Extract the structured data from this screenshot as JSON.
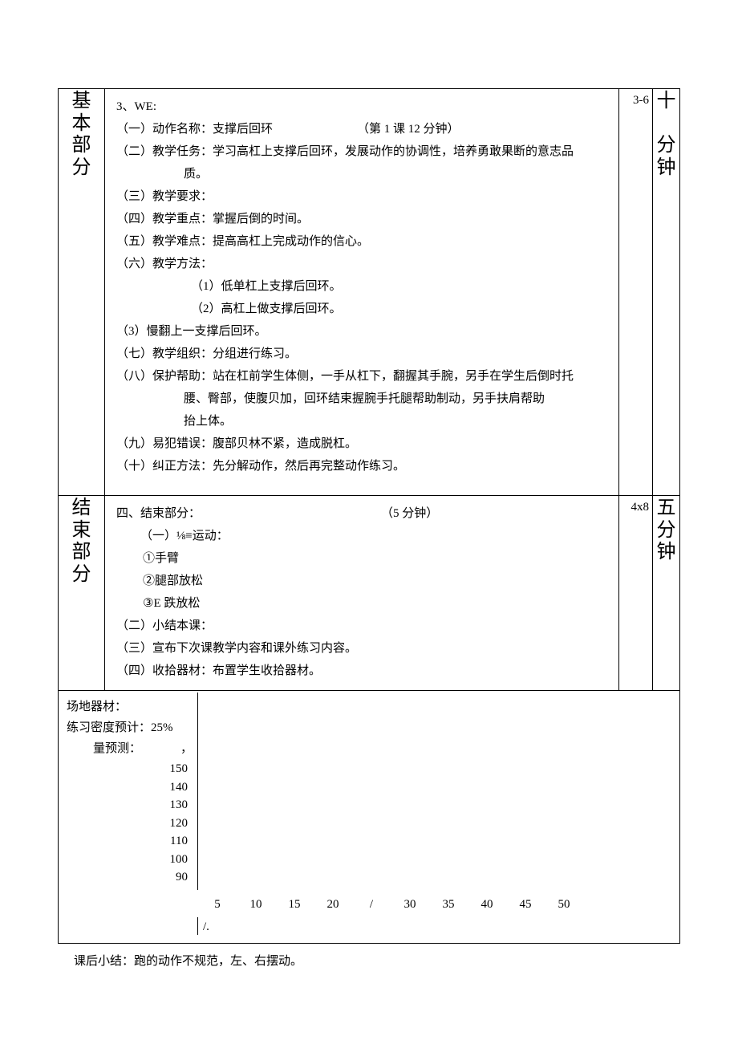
{
  "sections": {
    "basic": {
      "title_chars": [
        "基",
        "本",
        "部",
        "分"
      ],
      "count": "3-6",
      "time_chars": [
        "十",
        "",
        "分",
        "钟"
      ],
      "lines": {
        "l3": "3、WE:",
        "l_a": "（一）动作名称：支撑后回环",
        "l_a_right": "（第 1 课 12 分钟）",
        "l_b": "（二）教学任务：学习高杠上支撑后回环，发展动作的协调性，培养勇敢果断的意志品",
        "l_b2": "质。",
        "l_c": "（三）教学要求：",
        "l_d": "（四）教学重点：掌握后倒的时间。",
        "l_e": "（五）教学难点：提高高杠上完成动作的信心。",
        "l_f": "（六）教学方法：",
        "l_f1": "（1）低单杠上支撑后回环。",
        "l_f2": "（2）高杠上做支撑后回环。",
        "l_f3": "（3）慢翻上一支撑后回环。",
        "l_g": "（七）教学组织：分组进行练习。",
        "l_h": "（八）保护帮助：站在杠前学生体侧，一手从杠下，翻握其手腕，另手在学生后倒时托",
        "l_h2": "腰、臀部，使腹贝加，回环结束握腕手托腿帮助制动，另手扶肩帮助",
        "l_h3": "抬上体。",
        "l_i": "（九）易犯错误：腹部贝林不紧，造成脱杠。",
        "l_j": "（十）纠正方法：先分解动作，然后再完整动作练习。"
      }
    },
    "end": {
      "title_chars": [
        "结",
        "束",
        "部",
        "分"
      ],
      "count": "4x8",
      "time_chars": [
        "五",
        "分",
        "钟"
      ],
      "lines": {
        "hdr_left": "四、结束部分：",
        "hdr_right": "（5 分钟）",
        "a": "（一）⅛≡运动：",
        "a1": "①手臂",
        "a2": "②腿部放松",
        "a3": "③E 跌放松",
        "b": "（二）小结本课：",
        "c": "（三）宣布下次课教学内容和课外练习内容。",
        "d": "（四）收拾器材：布置学生收拾器材。"
      }
    }
  },
  "footer": {
    "site": "场地器材：",
    "density": "练习密度预计：25%",
    "load": "量预测：",
    "load_tail": "，",
    "slash": "/."
  },
  "chart_data": {
    "type": "line",
    "title": "",
    "xlabel": "",
    "ylabel": "",
    "y_ticks": [
      150,
      140,
      130,
      120,
      110,
      100,
      90
    ],
    "x_ticks": [
      "5",
      "10",
      "15",
      "20",
      "/",
      "30",
      "35",
      "40",
      "45",
      "50"
    ],
    "ylim": [
      90,
      150
    ],
    "series": []
  },
  "bottom_note": "课后小结：跑的动作不规范，左、右摆动。"
}
